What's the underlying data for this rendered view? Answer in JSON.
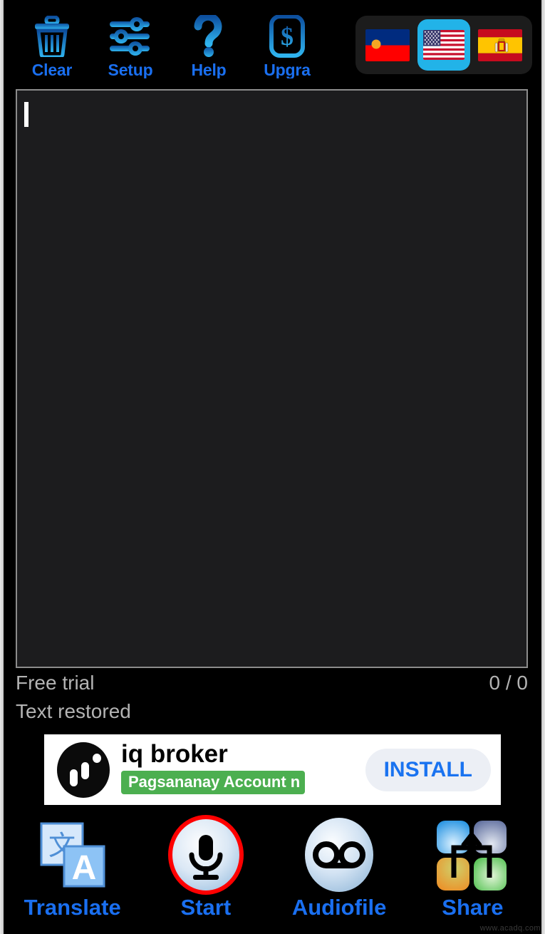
{
  "toolbar": {
    "buttons": [
      {
        "label": "Clear",
        "icon": "trash-icon"
      },
      {
        "label": "Setup",
        "icon": "sliders-icon"
      },
      {
        "label": "Help",
        "icon": "question-mark-icon"
      },
      {
        "label": "Upgra",
        "icon": "dollar-square-icon"
      }
    ],
    "flags": [
      {
        "name": "liechtenstein-flag",
        "selected": false
      },
      {
        "name": "united-states-flag",
        "selected": true
      },
      {
        "name": "spain-flag",
        "selected": false
      }
    ]
  },
  "editor": {
    "value": "",
    "placeholder": ""
  },
  "status": {
    "plan_label": "Free trial",
    "counter": "0 / 0",
    "message": "Text restored"
  },
  "ad": {
    "title": "iq broker",
    "badge": "Pagsananay Account n",
    "install_label": "INSTALL",
    "logo_icon": "iq-broker-logo-icon"
  },
  "bottom_nav": [
    {
      "label": "Translate",
      "icon": "translate-icon"
    },
    {
      "label": "Start",
      "icon": "microphone-icon"
    },
    {
      "label": "Audiofile",
      "icon": "voicemail-icon"
    },
    {
      "label": "Share",
      "icon": "share-icon"
    }
  ],
  "watermark": "www.acadq.com",
  "colors": {
    "background": "#000000",
    "accent_blue": "#1a6ff0",
    "label_blue": "#1a6ff0",
    "selected_flag": "#22b3e8",
    "editor_bg": "#1c1c1e",
    "editor_border": "#8c8c8c",
    "status_text": "#b3b3b3",
    "badge_green": "#4caf50",
    "install_text": "#1a73f0",
    "record_ring": "#ff0000"
  }
}
